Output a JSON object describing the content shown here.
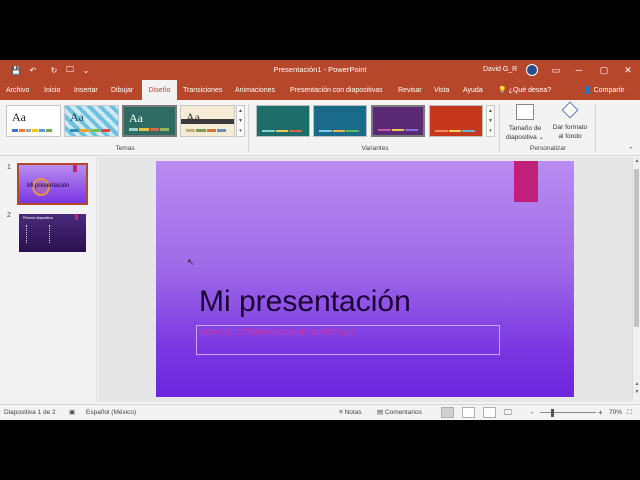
{
  "titlebar": {
    "title": "Presentación1  -  PowerPoint",
    "user": "David G_R",
    "save_icon": "💾",
    "undo_icon": "↶",
    "redo_icon": "↻",
    "present_icon": "🖵",
    "customize_icon": "⌄",
    "ribbon_display_icon": "▭",
    "minimize_icon": "─",
    "maximize_icon": "▢",
    "close_icon": "✕"
  },
  "tabs": [
    "Archivo",
    "Inicio",
    "Insertar",
    "Dibujar",
    "Diseño",
    "Transiciones",
    "Animaciones",
    "Presentación con diapositivas",
    "Revisar",
    "Vista",
    "Ayuda"
  ],
  "active_tab": "Diseño",
  "tell_me": "¿Qué desea?",
  "share": "Compartir",
  "ribbon": {
    "themes_label": "Temas",
    "variants_label": "Variantes",
    "customize_label": "Personalizar",
    "theme_aa": "Aa",
    "slide_size_line1": "Tamaño de",
    "slide_size_line2": "diapositiva ⌄",
    "format_bg_line1": "Dar formato",
    "format_bg_line2": "al fondo",
    "gallery_up": "▲",
    "gallery_down": "▼",
    "gallery_more": "▾",
    "collapse": "⌃"
  },
  "thumbnails": [
    {
      "number": "1",
      "title": "Mi presentación"
    },
    {
      "number": "2",
      "title": "Primera diapositiva"
    }
  ],
  "slide": {
    "title": "Mi presentación",
    "subtitle_placeholder": "HAGA CLIC PARA AGREGAR SUBTÍTULO"
  },
  "status": {
    "slide_count": "Diapositiva 1 de 2",
    "language": "Español (México)",
    "notes": "Notas",
    "comments": "Comentarios",
    "zoom_minus": "-",
    "zoom_plus": "+",
    "zoom_value": "70%"
  },
  "colors": {
    "accent": "#b7472a",
    "slide_top": "#b98cf0",
    "slide_bottom": "#6d26dd",
    "slide_bar": "#c01f7a"
  }
}
